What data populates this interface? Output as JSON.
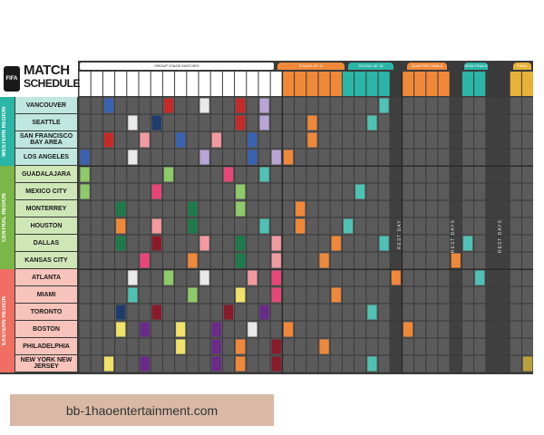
{
  "logo": {
    "mark_text": "FIFA",
    "title_line1": "MATCH",
    "title_line2": "SCHEDULE"
  },
  "headers": {
    "group_stage": "GROUP STAGE MATCHES",
    "round_of_32": "ROUND OF 32",
    "round_of_16": "ROUND OF 16",
    "quarter_finals": "QUARTER-FINALS",
    "semi_finals": "SEMI-FINALS",
    "final": "FINAL"
  },
  "regions": [
    {
      "name": "WESTERN REGION",
      "color": "#2bb5a6",
      "light": "#bfe6df",
      "cities": [
        "VANCOUVER",
        "SEATTLE",
        "SAN FRANCISCO BAY AREA",
        "LOS ANGELES"
      ]
    },
    {
      "name": "CENTRAL REGION",
      "color": "#7ab648",
      "light": "#cfe6b7",
      "cities": [
        "GUADALAJARA",
        "MEXICO CITY",
        "MONTERREY",
        "HOUSTON",
        "DALLAS",
        "KANSAS CITY"
      ]
    },
    {
      "name": "EASTERN REGION",
      "color": "#ef6f62",
      "light": "#f7c3bb",
      "cities": [
        "ATLANTA",
        "MIAMI",
        "TORONTO",
        "BOSTON",
        "PHILADELPHIA",
        "NEW YORK NEW JERSEY"
      ]
    }
  ],
  "rest_days_labels": [
    "REST DAY",
    "REST DAYS",
    "REST DAYS"
  ],
  "colors": {
    "poster_bg": "#3a3a3a",
    "cell": "#5b5b5b",
    "group_header": "#ffffff",
    "round_of_32": "#f0883a",
    "round_of_16": "#2bb5a6",
    "quarter_finals": "#f0883a",
    "semi_finals": "#2bb5a6",
    "final": "#e8b23a",
    "final_match": "#b8a13a"
  },
  "caption": "bb-1haoentertainment.com"
}
